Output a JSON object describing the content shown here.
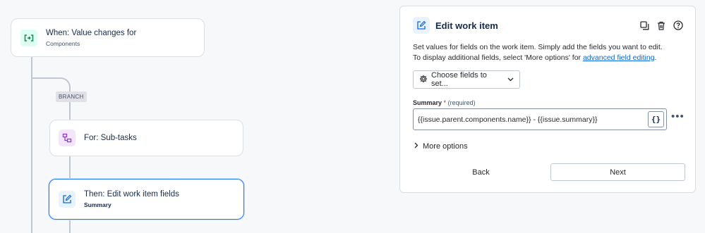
{
  "flow": {
    "trigger": {
      "title": "When: Value changes for",
      "subtitle": "Components",
      "icon": "value-change-icon"
    },
    "branch_tag": "BRANCH",
    "branch": {
      "title": "For: Sub-tasks",
      "icon": "subtasks-branch-icon"
    },
    "action": {
      "title": "Then: Edit work item fields",
      "subtitle": "Summary",
      "icon": "edit-icon"
    }
  },
  "panel": {
    "title": "Edit work item",
    "icon": "edit-icon",
    "header_actions": [
      "duplicate-icon",
      "delete-icon",
      "help-icon"
    ],
    "description_line1": "Set values for fields on the work item. Simply add the fields you want to edit.",
    "description_line2": "To display additional fields, select 'More options' for ",
    "description_link": "advanced field editing",
    "description_end": ".",
    "choose_fields_label": "Choose fields to set...",
    "summary_label": "Summary",
    "summary_asterisk": "*",
    "summary_required": "(required)",
    "summary_value": "{{issue.parent.components.name}} - {{issue.summary}}",
    "smart_value_button": "{}",
    "more_dots": "•••",
    "more_options_label": "More options",
    "back_label": "Back",
    "next_label": "Next"
  },
  "colors": {
    "accent": "#0c66e4",
    "selected_border": "#1d7afc",
    "trigger_icon_bg": "#dcfff1",
    "branch_icon_bg": "#f3e6fc",
    "action_icon_bg": "#e9f2ff"
  }
}
